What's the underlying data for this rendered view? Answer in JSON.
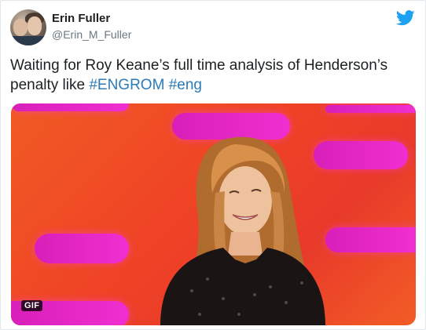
{
  "user": {
    "display_name": "Erin Fuller",
    "handle": "@Erin_M_Fuller"
  },
  "tweet": {
    "text": "Waiting for Roy Keane’s full time analysis of Henderson’s penalty like ",
    "hashtags": [
      "#ENGROM",
      "#eng"
    ]
  },
  "media": {
    "badge": "GIF"
  },
  "icons": {
    "brand": "twitter-bird-icon"
  },
  "colors": {
    "hashtag": "#2b7bb9",
    "brand": "#1da1f2"
  }
}
